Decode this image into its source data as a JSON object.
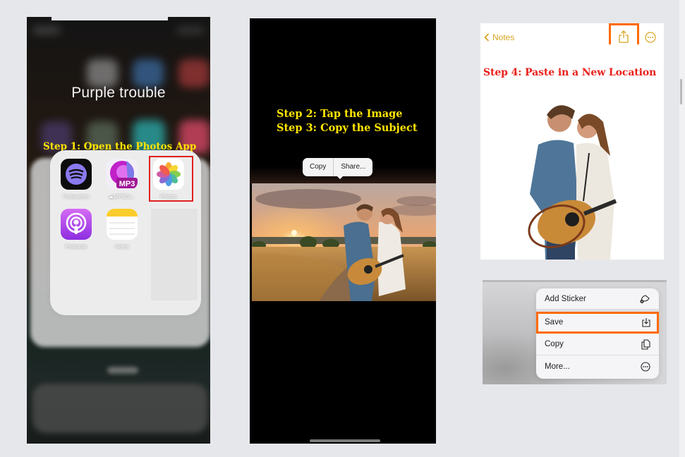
{
  "background_color": "#e6e7eb",
  "panel1": {
    "folder_title": "Purple trouble",
    "step_caption": "Step 1: Open the Photos App",
    "apps": [
      {
        "label": "Podcasters",
        "icon": "podcasters-icon"
      },
      {
        "label": "MP3Co...",
        "icon": "mp3-converter-icon",
        "badge": "MP3",
        "status_icon": "icloud-download-icon"
      },
      {
        "label": "Photos",
        "icon": "photos-icon",
        "highlighted": true
      },
      {
        "label": "Podcasts",
        "icon": "podcasts-icon"
      },
      {
        "label": "Notes",
        "icon": "notes-icon"
      }
    ],
    "highlight_color": "#e11f1f",
    "caption_color": "#ffe500"
  },
  "panel2": {
    "step_caption_line1": "Step 2: Tap the Image",
    "step_caption_line2": "Step 3: Copy the Subject",
    "menu": {
      "copy": "Copy",
      "share": "Share..."
    },
    "image_description": "Couple with acoustic guitar in wheat field at sunset",
    "caption_color": "#ffe500"
  },
  "panel3": {
    "back_label": "Notes",
    "step_caption": "Step 4: Paste in a New Location",
    "image_description": "Cut-out subject: couple with acoustic guitar",
    "accent_color": "#d9a520",
    "highlight_color": "#ff6a00",
    "caption_color": "#e8201a"
  },
  "panel4": {
    "menu_items": [
      {
        "label": "Add Sticker",
        "icon": "add-sticker-icon"
      },
      {
        "label": "Save",
        "icon": "save-icon",
        "highlighted": true
      },
      {
        "label": "Copy",
        "icon": "copy-icon"
      },
      {
        "label": "More...",
        "icon": "more-icon"
      }
    ],
    "highlight_color": "#ff6a00"
  }
}
